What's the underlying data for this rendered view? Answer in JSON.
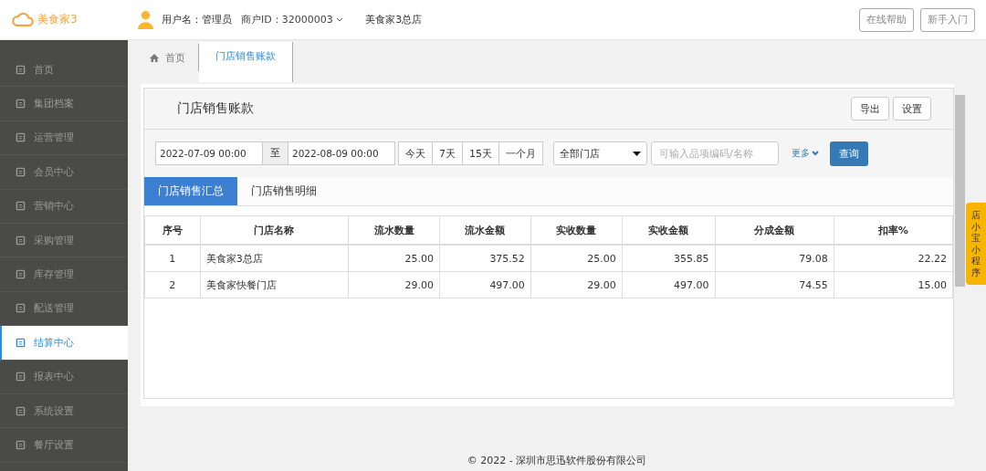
{
  "header": {
    "logo": "美食家3",
    "user": "用户名：管理员",
    "merchant": "商户ID：32000003",
    "store": "美食家3总店",
    "buttons": [
      "在线帮助",
      "新手入门"
    ]
  },
  "sidebar": {
    "items": [
      {
        "label": "首页",
        "selected": false
      },
      {
        "label": "集团档案",
        "selected": false
      },
      {
        "label": "运营管理",
        "selected": false
      },
      {
        "label": "会员中心",
        "selected": false
      },
      {
        "label": "营销中心",
        "selected": false
      },
      {
        "label": "采购管理",
        "selected": false
      },
      {
        "label": "库存管理",
        "selected": false
      },
      {
        "label": "配送管理",
        "selected": false
      },
      {
        "label": "结算中心",
        "selected": true
      },
      {
        "label": "报表中心",
        "selected": false
      },
      {
        "label": "系统设置",
        "selected": false
      },
      {
        "label": "餐厅设置",
        "selected": false
      }
    ]
  },
  "page_tabs": [
    {
      "label": "首页",
      "selected": false
    },
    {
      "label": "门店销售账款",
      "selected": true
    }
  ],
  "panel": {
    "title": "门店销售账款",
    "actions": [
      "导出",
      "设置"
    ],
    "filter": {
      "start": "2022-07-09 00:00",
      "separator": "至",
      "end": "2022-08-09 00:00",
      "ranges": [
        "今天",
        "7天",
        "15天",
        "一个月"
      ],
      "store_select": "全部门店",
      "search_placeholder": "可输入品项编码/名称",
      "more": "更多",
      "query": "查询"
    },
    "subtabs": [
      {
        "label": "门店销售汇总",
        "selected": true
      },
      {
        "label": "门店销售明细",
        "selected": false
      }
    ],
    "table": {
      "columns": [
        "序号",
        "门店名称",
        "流水数量",
        "流水金额",
        "实收数量",
        "实收金额",
        "分成金额",
        "扣率%"
      ],
      "rows": [
        [
          "1",
          "美食家3总店",
          "25.00",
          "375.52",
          "25.00",
          "355.85",
          "79.08",
          "22.22"
        ],
        [
          "2",
          "美食家快餐门店",
          "29.00",
          "497.00",
          "29.00",
          "497.00",
          "74.55",
          "15.00"
        ]
      ]
    }
  },
  "float_tab": "店小宝小程序",
  "footer": "© 2022 - 深圳市思迅软件股份有限公司"
}
